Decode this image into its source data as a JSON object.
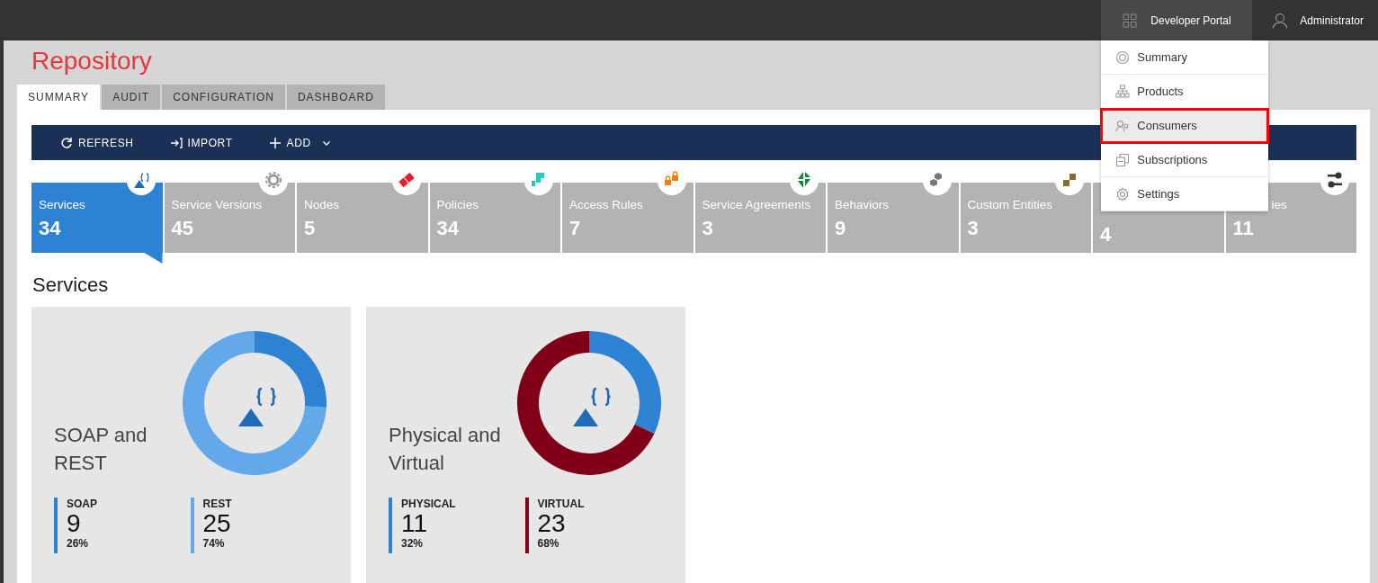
{
  "top_bar": {
    "portal_button": "Developer Portal",
    "user": "Administrator"
  },
  "portal_menu": [
    {
      "label": "Summary",
      "selected": false,
      "outlined": false
    },
    {
      "label": "Products",
      "selected": false,
      "outlined": false
    },
    {
      "label": "Consumers",
      "selected": true,
      "outlined": true
    },
    {
      "label": "Subscriptions",
      "selected": false,
      "outlined": false
    },
    {
      "label": "Settings",
      "selected": false,
      "outlined": false
    }
  ],
  "page": {
    "title": "Repository"
  },
  "tabs": [
    {
      "label": "SUMMARY",
      "selected": true
    },
    {
      "label": "AUDIT",
      "selected": false
    },
    {
      "label": "CONFIGURATION",
      "selected": false
    },
    {
      "label": "DASHBOARD",
      "selected": false
    }
  ],
  "toolbar": [
    {
      "label": "REFRESH",
      "kind": "refresh",
      "dropdown": false
    },
    {
      "label": "IMPORT",
      "kind": "import",
      "dropdown": false
    },
    {
      "label": "ADD",
      "kind": "add",
      "dropdown": true
    }
  ],
  "tiles": [
    {
      "label": "Services",
      "count": "34",
      "selected": true
    },
    {
      "label": "Service Versions",
      "count": "45",
      "selected": false
    },
    {
      "label": "Nodes",
      "count": "5",
      "selected": false
    },
    {
      "label": "Policies",
      "count": "34",
      "selected": false
    },
    {
      "label": "Access Rules",
      "count": "7",
      "selected": false
    },
    {
      "label": "Service Agreements",
      "count": "3",
      "selected": false
    },
    {
      "label": "Behaviors",
      "count": "9",
      "selected": false
    },
    {
      "label": "Custom Entities",
      "count": "3",
      "selected": false
    },
    {
      "count": "4",
      "selected": false
    },
    {
      "label": "ies",
      "label_cut": true,
      "count": "11",
      "selected": false
    }
  ],
  "section_title": "Services",
  "cards": [
    {
      "title": "SOAP and REST",
      "chart_data": {
        "type": "donut",
        "categories": [
          "SOAP",
          "REST"
        ],
        "values": [
          26,
          74
        ]
      },
      "legend": [
        {
          "count": "9",
          "percent": "26%",
          "color": "#2e82d4"
        },
        {
          "count": "25",
          "percent": "74%",
          "color": "#63a8e8"
        }
      ]
    },
    {
      "title": "Physical and Virtual",
      "chart_data": {
        "type": "donut",
        "categories": [
          "PHYSICAL",
          "VIRTUAL"
        ],
        "values": [
          32,
          68
        ]
      },
      "legend": [
        {
          "count": "11",
          "percent": "32%",
          "color": "#2e82d4"
        },
        {
          "count": "23",
          "percent": "68%",
          "color": "#800018"
        }
      ]
    }
  ]
}
